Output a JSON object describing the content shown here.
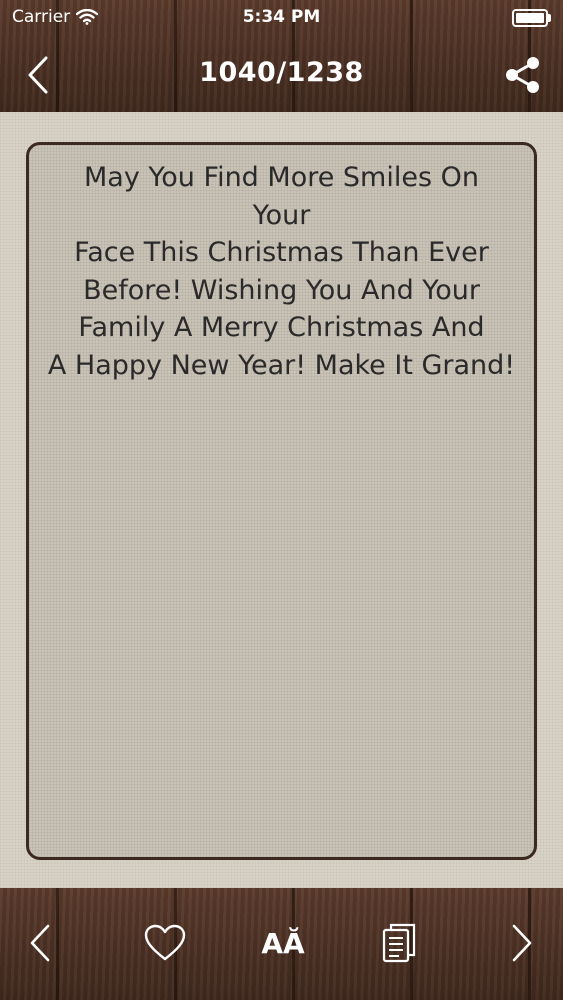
{
  "status_bar": {
    "carrier": "Carrier",
    "time": "5:34 PM",
    "icons": [
      "wifi-icon",
      "battery-icon"
    ]
  },
  "nav": {
    "title": "1040/1238",
    "icons": [
      "chevron-left-icon",
      "share-icon"
    ]
  },
  "card": {
    "lines": [
      "May You Find More Smiles On",
      "Your",
      "Face This Christmas Than Ever",
      "Before! Wishing You And Your",
      "Family A Merry Christmas And",
      "A Happy New Year! Make It Grand!"
    ]
  },
  "toolbar": {
    "font_label": "AĂ",
    "icons": [
      "chevron-left-icon",
      "heart-icon",
      "font-size-icon",
      "copy-icon",
      "chevron-right-icon"
    ]
  },
  "colors": {
    "wood": "#4a2f22",
    "paper": "#d9d3c7",
    "card_border": "#3c2a20",
    "text": "#2a2a2a"
  }
}
